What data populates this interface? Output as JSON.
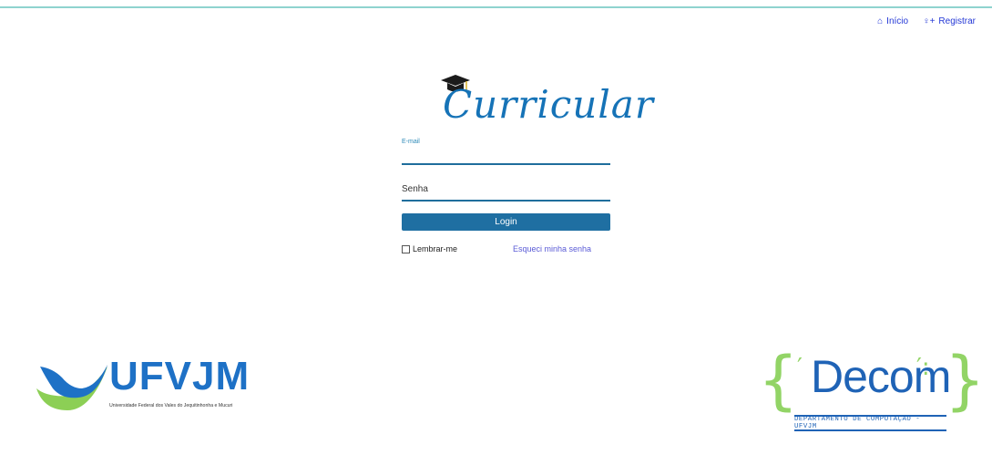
{
  "nav": {
    "home_label": "Início",
    "register_label": "Registrar",
    "home_icon": "house-icon",
    "register_icon": "user-plus-icon"
  },
  "logo": {
    "text": "Curricular"
  },
  "form": {
    "email_label": "E-mail",
    "password_label": "Senha",
    "login_button": "Login",
    "remember_label": "Lembrar-me",
    "forgot_link": "Esqueci minha senha"
  },
  "footer": {
    "ufvjm_name": "UFVJM",
    "ufvjm_subtitle": "Universidade Federal dos Vales do Jequitinhonha e Mucuri",
    "decom_name": "Decom",
    "decom_subtitle": "DEPARTAMENTO DE COMPUTAÇÃO - UFVJM"
  },
  "colors": {
    "primary": "#1f6fa2",
    "accent_link": "#5a5bd6",
    "nav_link": "#2438d6",
    "decom_green": "#92d466",
    "ufvjm_blue": "#1e71c6"
  }
}
